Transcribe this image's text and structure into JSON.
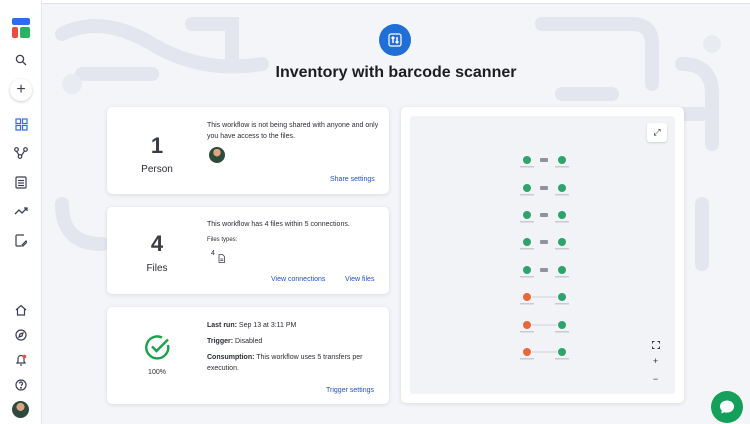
{
  "sidebar": {
    "icons": [
      "app-logo",
      "search-icon",
      "add-icon",
      "dashboard-icon",
      "workflow-icon",
      "list-icon",
      "analytics-icon",
      "edit-document-icon",
      "home-icon",
      "explore-icon",
      "notifications-icon",
      "help-icon",
      "user-avatar"
    ]
  },
  "header": {
    "icon": "import-export-arrows-icon",
    "title": "Inventory with barcode scanner"
  },
  "people_card": {
    "count": "1",
    "label": "Person",
    "description": "This workflow is not being shared with anyone and only you have access to the files.",
    "link": "Share settings"
  },
  "files_card": {
    "count": "4",
    "label": "Files",
    "description": "This workflow has 4 files within 5 connections.",
    "types_label": "Files types:",
    "types_count": "4",
    "links": [
      "View connections",
      "View files"
    ]
  },
  "status_card": {
    "percent": "100%",
    "last_run_label": "Last run:",
    "last_run_value": "Sep 13 at 3:11 PM",
    "trigger_label": "Trigger:",
    "trigger_value": "Disabled",
    "consumption_label": "Consumption:",
    "consumption_value": "This workflow uses 5 transfers per execution.",
    "link": "Trigger settings"
  },
  "preview": {
    "expand_icon": "expand-icon",
    "controls": [
      "fit-view-icon",
      "zoom-in-icon",
      "zoom-out-icon"
    ],
    "zoom_in": "+",
    "zoom_out": "−"
  },
  "colors": {
    "accent": "#1f6fd6",
    "link": "#2350c8",
    "success": "#18a34a",
    "chat": "#14a05a"
  }
}
